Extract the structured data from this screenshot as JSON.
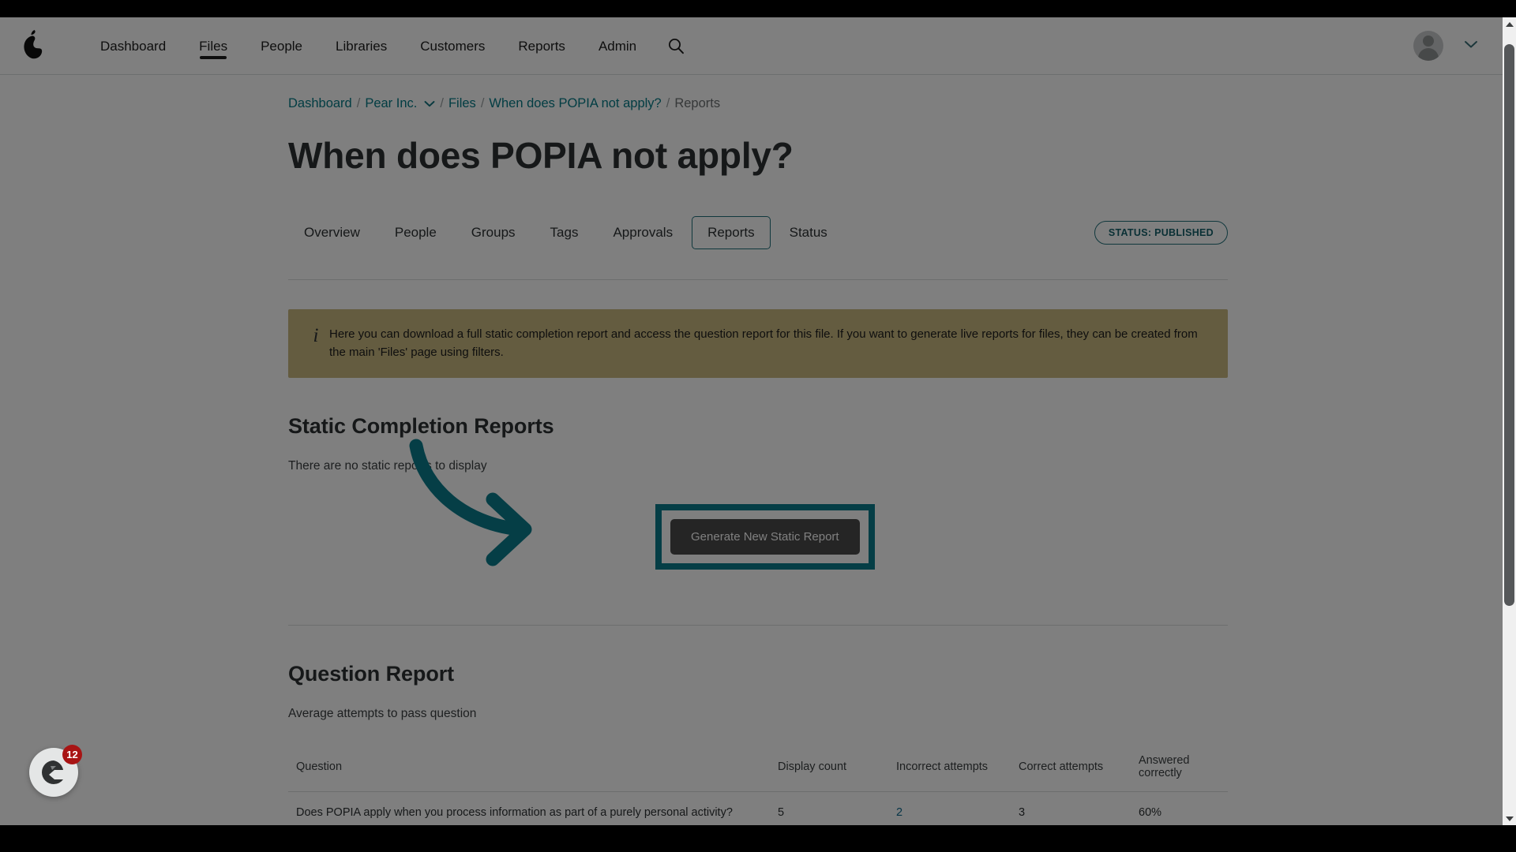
{
  "nav": {
    "logo_icon": "pear-logo-icon",
    "links": [
      {
        "label": "Dashboard",
        "active": false
      },
      {
        "label": "Files",
        "active": true
      },
      {
        "label": "People",
        "active": false
      },
      {
        "label": "Libraries",
        "active": false
      },
      {
        "label": "Customers",
        "active": false
      },
      {
        "label": "Reports",
        "active": false
      },
      {
        "label": "Admin",
        "active": false
      }
    ],
    "search_icon": "search-icon",
    "avatar_icon": "user-avatar-icon",
    "account_caret_icon": "chevron-down-icon"
  },
  "breadcrumb": {
    "items": [
      {
        "label": "Dashboard",
        "current": false,
        "has_caret": false
      },
      {
        "label": "Pear Inc.",
        "current": false,
        "has_caret": true
      },
      {
        "label": "Files",
        "current": false,
        "has_caret": false
      },
      {
        "label": "When does POPIA not apply?",
        "current": false,
        "has_caret": false
      },
      {
        "label": "Reports",
        "current": true,
        "has_caret": false
      }
    ],
    "separator": "/"
  },
  "page": {
    "title": "When does POPIA not apply?"
  },
  "tabs": {
    "items": [
      {
        "label": "Overview",
        "selected": false
      },
      {
        "label": "People",
        "selected": false
      },
      {
        "label": "Groups",
        "selected": false
      },
      {
        "label": "Tags",
        "selected": false
      },
      {
        "label": "Approvals",
        "selected": false
      },
      {
        "label": "Reports",
        "selected": true
      },
      {
        "label": "Status",
        "selected": false
      }
    ],
    "status_badge": "STATUS: PUBLISHED"
  },
  "info_banner": {
    "icon": "info-italic-i-icon",
    "text": "Here you can download a full static completion report and access the question report for this file. If you want to generate live reports for files, they can be created from the main 'Files' page using filters.",
    "background_color": "#c9b981"
  },
  "static_reports": {
    "heading": "Static Completion Reports",
    "empty_message": "There are no static reports to display",
    "generate_button": "Generate New Static Report",
    "highlight_color": "#0b7d8c",
    "annotation_arrow_icon": "curved-arrow-icon"
  },
  "question_report": {
    "heading": "Question Report",
    "subtitle": "Average attempts to pass question",
    "columns": [
      "Question",
      "Display count",
      "Incorrect attempts",
      "Correct attempts",
      "Answered correctly"
    ],
    "rows": [
      {
        "question": "Does POPIA apply when you process information as part of a purely personal activity?",
        "display_count": "5",
        "incorrect_attempts": "2",
        "correct_attempts": "3",
        "answered_correctly": "60%"
      }
    ]
  },
  "chat_widget": {
    "icon": "chat-launcher-icon",
    "badge_count": "12",
    "badge_color": "#a81414"
  },
  "scrollbar": {
    "up_icon": "scroll-up-arrow-icon",
    "down_icon": "scroll-down-arrow-icon",
    "thumb_name": "vertical-scroll-thumb"
  }
}
